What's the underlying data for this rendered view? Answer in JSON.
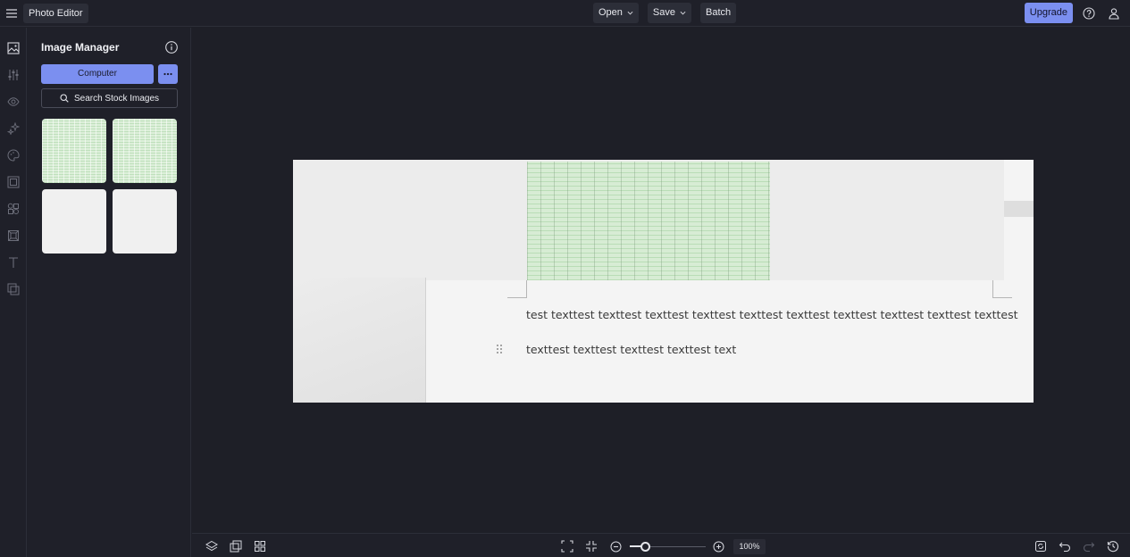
{
  "app": {
    "title": "Photo Editor"
  },
  "topbar": {
    "open_label": "Open",
    "save_label": "Save",
    "batch_label": "Batch",
    "upgrade_label": "Upgrade"
  },
  "rail": {
    "items": [
      "image-icon",
      "sliders-icon",
      "eye-icon",
      "sparkles-icon",
      "palette-icon",
      "frame-icon",
      "shapes-icon",
      "texture-icon",
      "text-icon",
      "overlay-icon"
    ]
  },
  "panel": {
    "title": "Image Manager",
    "computer_label": "Computer",
    "search_label": "Search Stock Images"
  },
  "canvas": {
    "line1": "test texttest texttest texttest texttest texttest texttest texttest texttest texttest texttest",
    "line2": "texttest texttest texttest texttest text"
  },
  "bottombar": {
    "zoom_label": "100%",
    "zoom_fraction": 0.2
  },
  "colors": {
    "accent": "#7b8ff0",
    "background": "#1e1f27",
    "panel": "#1f2029"
  }
}
